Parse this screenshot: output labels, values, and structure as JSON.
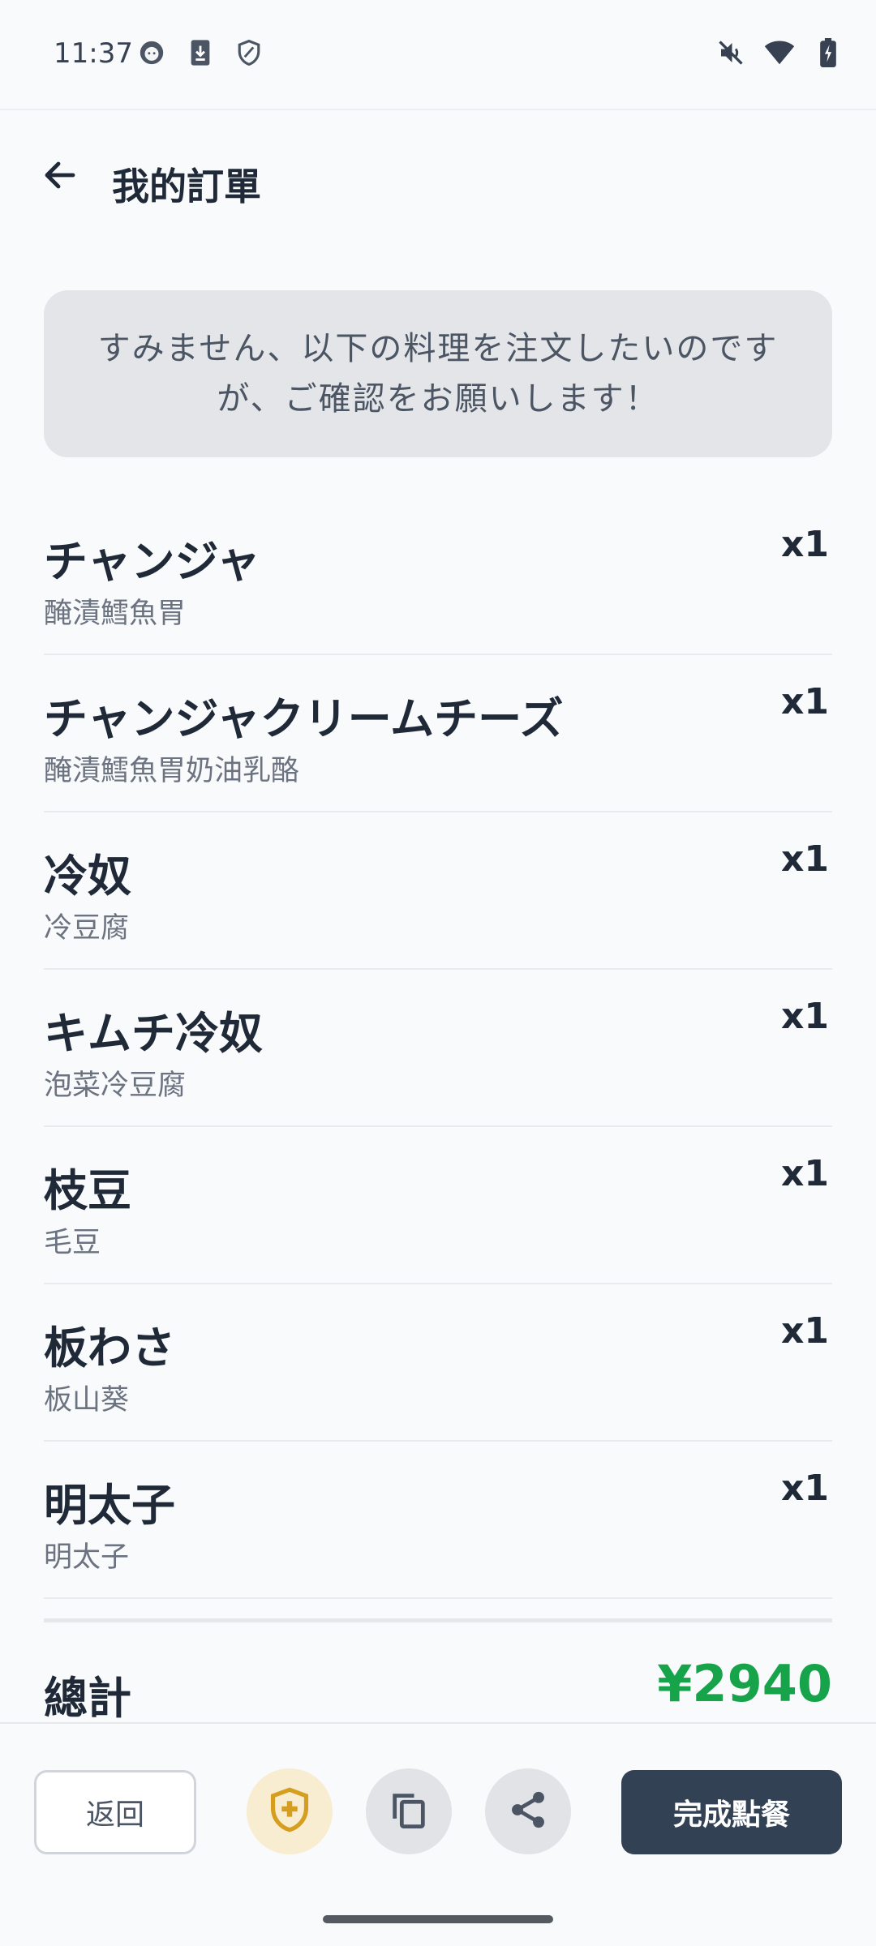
{
  "status_bar": {
    "time": "11:37",
    "left_icons": [
      "face-icon",
      "download-icon",
      "shield-outline-icon"
    ],
    "right_icons": [
      "mute-icon",
      "wifi-icon",
      "battery-charging-icon"
    ]
  },
  "header": {
    "title": "我的訂單",
    "back_icon": "arrow-left-icon"
  },
  "banner": {
    "text": "すみません、以下の料理を注文したいのですが、ご確認をお願いします！"
  },
  "items": [
    {
      "name": "チャンジャ",
      "sub": "醃漬鱈魚胃",
      "qty": "x1"
    },
    {
      "name": "チャンジャクリームチーズ",
      "sub": "醃漬鱈魚胃奶油乳酪",
      "qty": "x1"
    },
    {
      "name": "冷奴",
      "sub": "冷豆腐",
      "qty": "x1"
    },
    {
      "name": "キムチ冷奴",
      "sub": "泡菜冷豆腐",
      "qty": "x1"
    },
    {
      "name": "枝豆",
      "sub": "毛豆",
      "qty": "x1"
    },
    {
      "name": "板わさ",
      "sub": "板山葵",
      "qty": "x1"
    },
    {
      "name": "明太子",
      "sub": "明太子",
      "qty": "x1"
    }
  ],
  "total": {
    "label": "總計",
    "value": "¥2940"
  },
  "bottom_bar": {
    "back_label": "返回",
    "done_label": "完成點餐",
    "icons": [
      "shield-plus-icon",
      "copy-icon",
      "share-icon"
    ]
  },
  "colors": {
    "accent_total": "#16a34a",
    "primary_button": "#334155",
    "shield_button_bg": "#f8ecd1",
    "shield_icon": "#d69e1e",
    "icon_button_bg": "#e2e3e6"
  }
}
